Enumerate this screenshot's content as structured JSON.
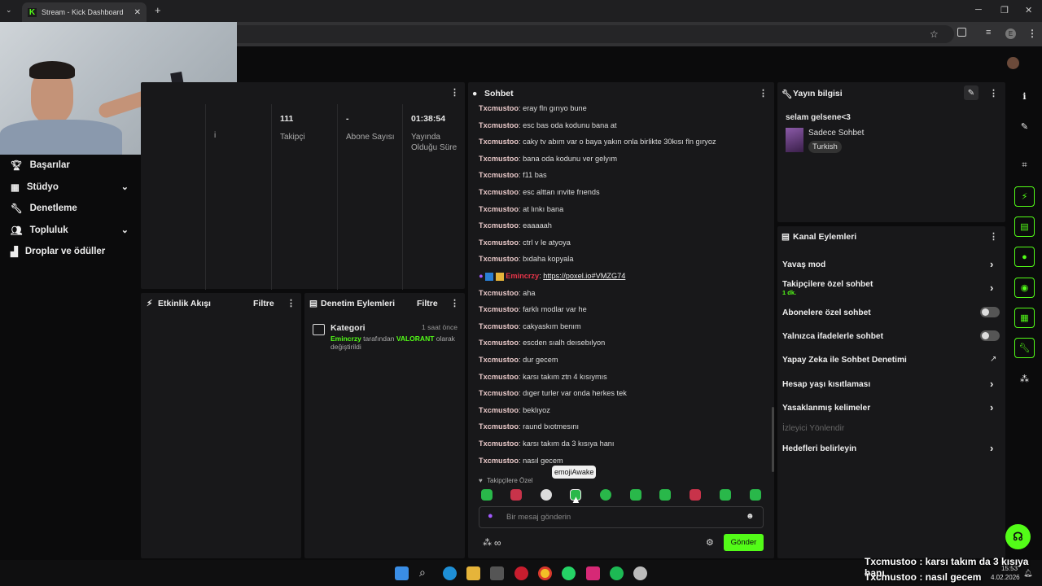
{
  "browser": {
    "tab_title": "Stream - Kick Dashboard",
    "new_tab": "+",
    "avatar_letter": "E"
  },
  "sidebar": {
    "items": [
      {
        "label": "Başarılar",
        "icon": "trophy-icon"
      },
      {
        "label": "Stüdyo",
        "icon": "studio-icon",
        "expandable": true
      },
      {
        "label": "Denetleme",
        "icon": "wrench-icon"
      },
      {
        "label": "Topluluk",
        "icon": "community-icon",
        "expandable": true
      },
      {
        "label": "Droplar ve ödüller",
        "icon": "gift-icon"
      }
    ]
  },
  "stats": [
    {
      "value": "111",
      "label": "Takipçi"
    },
    {
      "value": "-",
      "label": "Abone Sayısı"
    },
    {
      "value": "01:38:54",
      "label": "Yayında Olduğu Süre"
    }
  ],
  "stats_partial_label": "i",
  "activity": {
    "title": "Etkinlik Akışı",
    "filter": "Filtre"
  },
  "mod_actions": {
    "title": "Denetim Eylemleri",
    "filter": "Filtre",
    "entry": {
      "title": "Kategori",
      "time": "1 saat önce",
      "user": "Emincrzy",
      "text1": " tarafından ",
      "category": "VALORANT",
      "text2": " olarak",
      "text3": "değiştirildi"
    }
  },
  "chat": {
    "title": "Sohbet",
    "messages": [
      {
        "user": "Txcmustoo",
        "text": "eray fln gırıyo bune"
      },
      {
        "user": "Txcmustoo",
        "text": "esc bas oda kodunu bana at"
      },
      {
        "user": "Txcmustoo",
        "text": "caky tv abım var o baya yakın onla birlikte 30kısı fln gıryoz"
      },
      {
        "user": "Txcmustoo",
        "text": "bana oda kodunu ver gelyım"
      },
      {
        "user": "Txcmustoo",
        "text": "f11 bas"
      },
      {
        "user": "Txcmustoo",
        "text": "esc alttan ınvite frıends"
      },
      {
        "user": "Txcmustoo",
        "text": "at lınkı bana"
      },
      {
        "user": "Txcmustoo",
        "text": "eaaaaah"
      },
      {
        "user": "Txcmustoo",
        "text": "ctrl v le atyoya"
      },
      {
        "user": "Txcmustoo",
        "text": "bıdaha kopyala"
      },
      {
        "user": "Emincrzy",
        "text": "https://poxel.io#VMZG74",
        "special": true
      },
      {
        "user": "Txcmustoo",
        "text": "aha"
      },
      {
        "user": "Txcmustoo",
        "text": "farklı modlar var he"
      },
      {
        "user": "Txcmustoo",
        "text": "cakyaskım benım"
      },
      {
        "user": "Txcmustoo",
        "text": "escden sıalh deısebılyon"
      },
      {
        "user": "Txcmustoo",
        "text": "dur gecem"
      },
      {
        "user": "Txcmustoo",
        "text": "karsı takım ztn 4 kısıymıs"
      },
      {
        "user": "Txcmustoo",
        "text": "dıger turler var onda herkes tek"
      },
      {
        "user": "Txcmustoo",
        "text": "beklıyoz"
      },
      {
        "user": "Txcmustoo",
        "text": "raund bıotmesını"
      },
      {
        "user": "Txcmustoo",
        "text": "karsı takım da 3 kısıya hanı"
      },
      {
        "user": "Txcmustoo",
        "text": "nasıl gecem"
      }
    ],
    "separator": ": ",
    "followers_only_label": "Takipçilere Özel",
    "tooltip": "emojiAwake",
    "input_placeholder": "Bir mesaj gönderin",
    "send_label": "Gönder"
  },
  "stream_info": {
    "title_label": "Yayın bilgisi",
    "stream_title": "selam gelsene<3",
    "category": "Sadece Sohbet",
    "language": "Turkish"
  },
  "channel_actions": {
    "title": "Kanal Eylemleri",
    "items": [
      {
        "label": "Yavaş mod",
        "control": "arrow"
      },
      {
        "label": "Takipçilere özel sohbet",
        "sub": "1 dk.",
        "control": "arrow"
      },
      {
        "label": "Abonelere özel sohbet",
        "control": "toggle"
      },
      {
        "label": "Yalnızca ifadelerle sohbet",
        "control": "toggle"
      },
      {
        "label": "Yapay Zeka ile Sohbet Denetimi",
        "control": "external"
      },
      {
        "label": "Hesap yaşı kısıtlaması",
        "control": "arrow"
      },
      {
        "label": "Yasaklanmış kelimeler",
        "control": "arrow"
      },
      {
        "label": "İzleyici Yönlendir",
        "control": "disabled"
      },
      {
        "label": "Hedefleri belirleyin",
        "control": "arrow"
      }
    ]
  },
  "overlay": {
    "line1": "Txcmustoo : karsı takım da 3 kısıya hanı",
    "line2": "Txcmustoo : nasıl gecem"
  },
  "taskbar": {
    "time": "15:53",
    "date": "4.02.2026"
  },
  "colors": {
    "accent": "#53fc18",
    "panel": "#18181a",
    "background": "#0b0b0c"
  }
}
